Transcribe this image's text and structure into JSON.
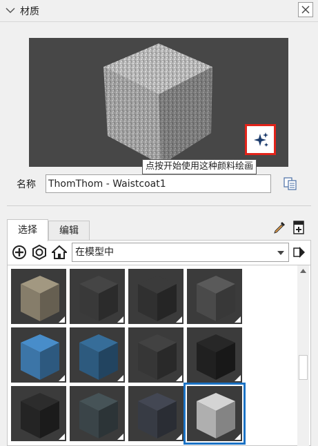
{
  "panel": {
    "title": "材质",
    "close_icon": "close-icon",
    "collapse_icon": "chevron-down-icon"
  },
  "preview": {
    "paint_button_icon": "sparkle-icon",
    "tooltip": "点按开始使用这种颜料绘画"
  },
  "name_field": {
    "label": "名称",
    "value": "ThomThom - Waistcoat1",
    "duplicate_icon": "duplicate-icon"
  },
  "tabs": [
    {
      "label": "选择",
      "active": true
    },
    {
      "label": "编辑",
      "active": false
    }
  ],
  "toolbar": {
    "create_icon": "add-material-icon",
    "sample_icon": "eyedropper-icon",
    "collection": "在模型中",
    "nav_icons": [
      "create-circle-icon",
      "model-materials-icon",
      "home-icon"
    ],
    "details_icon": "details-arrow-icon"
  },
  "swatches": [
    {
      "name": "beige",
      "color": "#8d8470",
      "selected": false
    },
    {
      "name": "dark-1",
      "color": "#3c3c3c",
      "selected": false
    },
    {
      "name": "dark-2",
      "color": "#333333",
      "selected": false
    },
    {
      "name": "gray-1",
      "color": "#4e4e4e",
      "selected": false
    },
    {
      "name": "blue-1",
      "color": "#3f7bb0",
      "selected": false
    },
    {
      "name": "blue-2",
      "color": "#2f5f85",
      "selected": false
    },
    {
      "name": "dark-3",
      "color": "#393939",
      "selected": false
    },
    {
      "name": "black-1",
      "color": "#222222",
      "selected": false
    },
    {
      "name": "black-2",
      "color": "#262626",
      "selected": false
    },
    {
      "name": "teal-gray",
      "color": "#3d484c",
      "selected": false
    },
    {
      "name": "slate",
      "color": "#3a3e48",
      "selected": false
    },
    {
      "name": "waistcoat",
      "color": "#b8b8b8",
      "selected": true
    }
  ],
  "colors": {
    "selection": "#1b72c4",
    "highlight": "#e2231a",
    "preview_bg": "#474747"
  }
}
